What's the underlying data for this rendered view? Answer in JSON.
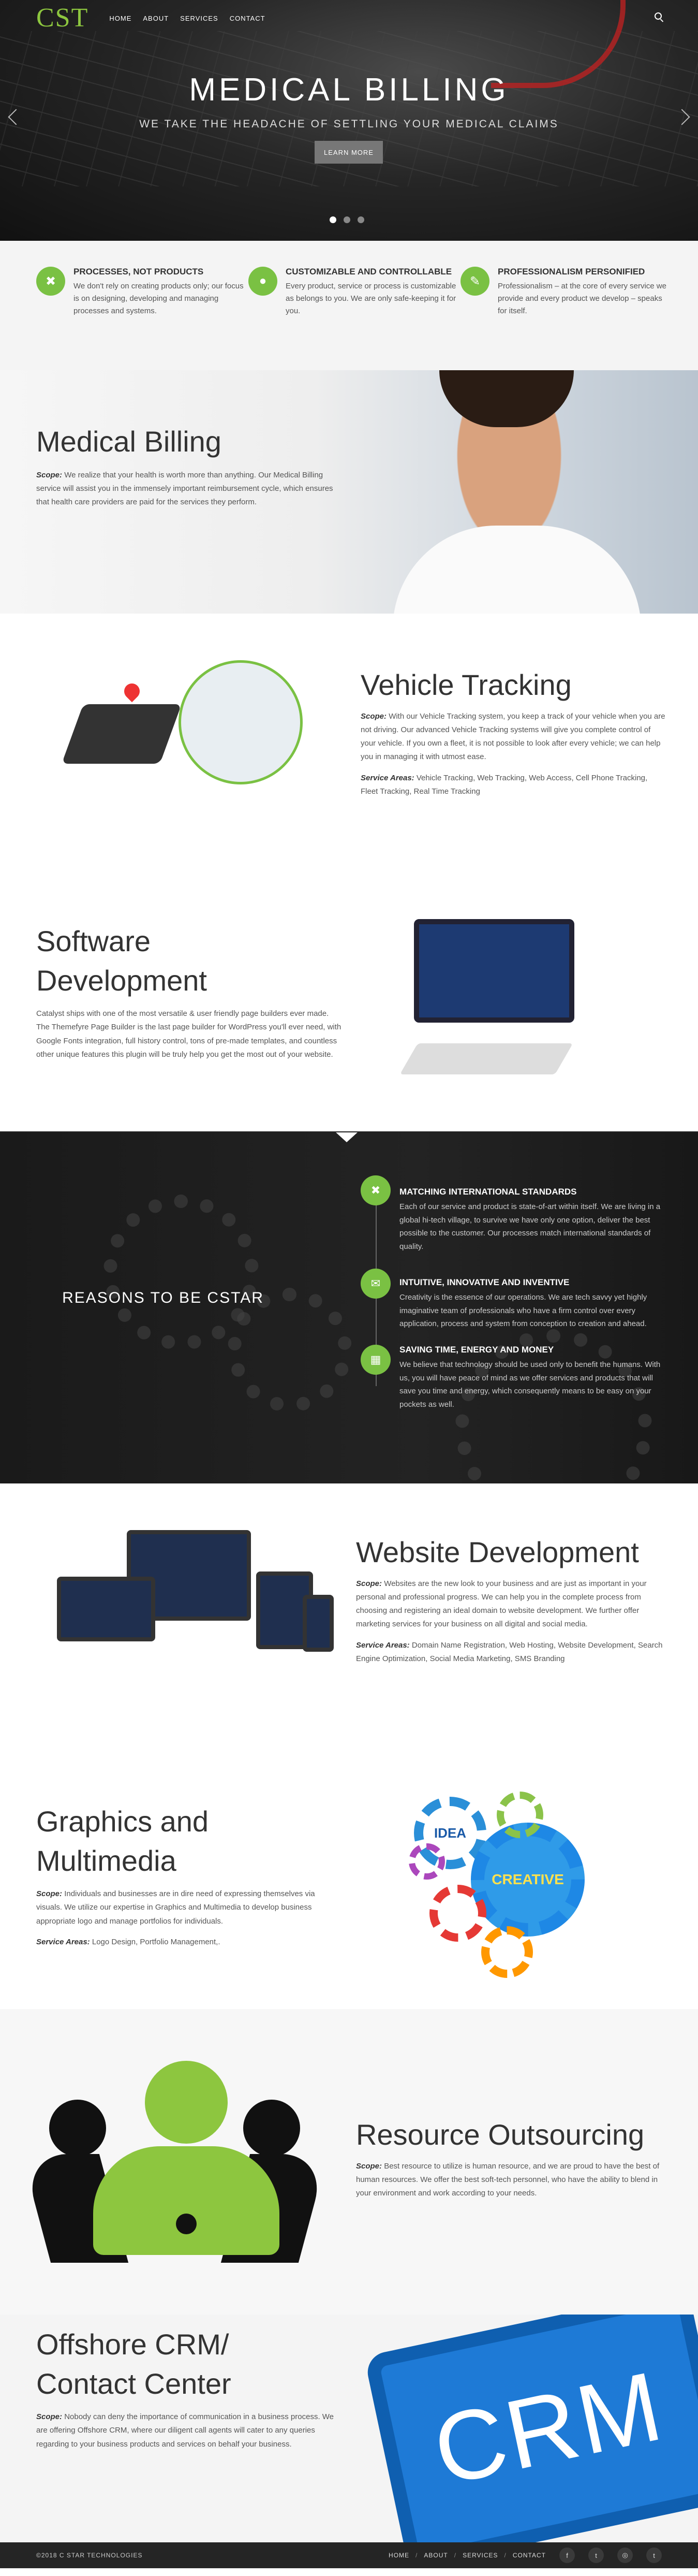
{
  "header": {
    "logo": "CST",
    "nav": [
      "HOME",
      "ABOUT",
      "SERVICES",
      "CONTACT"
    ]
  },
  "hero": {
    "title": "MEDICAL BILLING",
    "subtitle": "WE TAKE THE HEADACHE OF SETTLING YOUR MEDICAL CLAIMS",
    "button": "LEARN MORE",
    "slides": 3,
    "active_slide": 1
  },
  "features": [
    {
      "icon": "tools-icon",
      "glyph": "✖",
      "title": "PROCESSES, NOT PRODUCTS",
      "text": "We don't rely on creating products only; our focus is on designing, developing and managing processes and systems."
    },
    {
      "icon": "users-icon",
      "glyph": "●",
      "title": "CUSTOMIZABLE AND CONTROLLABLE",
      "text": "Every product, service or process is customizable as belongs to you. We are only safe-keeping it for you."
    },
    {
      "icon": "pencil-icon",
      "glyph": "✎",
      "title": "PROFESSIONALISM PERSONIFIED",
      "text": "Professionalism – at the core of every service we provide and every product we develop – speaks for itself."
    }
  ],
  "medical": {
    "title": "Medical Billing",
    "scope_label": "Scope:",
    "text": "We realize that your health is worth more than anything. Our Medical Billing service will assist you in the immensely important reimbursement cycle, which ensures that health care providers are paid for the services they perform."
  },
  "vehicle": {
    "title": "Vehicle Tracking",
    "scope_label": "Scope:",
    "text": "With our Vehicle Tracking system, you keep a track of your vehicle when you are not driving. Our advanced Vehicle Tracking systems will give you complete control of your vehicle. If you own a fleet, it is not possible to look after every vehicle; we can help you in managing it with utmost ease.",
    "areas_label": "Service Areas:",
    "areas": "Vehicle Tracking, Web Tracking, Web Access, Cell Phone Tracking, Fleet Tracking, Real Time Tracking"
  },
  "software": {
    "title_1": "Software",
    "title_2": "Development",
    "text": "Catalyst ships with one of the most versatile & user friendly page builders ever made. The Themefyre Page Builder is the last page builder for WordPress you'll ever need, with Google Fonts integration, full history control, tons of pre-made templates, and countless other unique features this plugin will be truly help you get the most out of your website."
  },
  "reasons": {
    "title": "REASONS TO BE CSTAR",
    "items": [
      {
        "icon": "tools-icon",
        "glyph": "✖",
        "title": "MATCHING INTERNATIONAL STANDARDS",
        "text": "Each of our service and product is state-of-art within itself. We are living in a global hi-tech village, to survive we have only one option, deliver the best possible to the customer. Our processes match international standards of quality."
      },
      {
        "icon": "chat-icon",
        "glyph": "✉",
        "title": "INTUITIVE, INNOVATIVE AND INVENTIVE",
        "text": "Creativity is the essence of our operations. We are tech savvy yet highly imaginative team of professionals who have a firm control over every application, process and system from conception to creation and ahead."
      },
      {
        "icon": "calendar-icon",
        "glyph": "▦",
        "title": "SAVING TIME, ENERGY AND MONEY",
        "text": "We believe that technology should be used only to benefit the humans. With us, you will have peace of mind as we offer services and products that will save you time and energy, which consequently means to be easy on your pockets as well."
      }
    ]
  },
  "website": {
    "title": "Website Development",
    "scope_label": "Scope:",
    "text": "Websites are the new look to your business and are just as important in your personal and professional progress. We can help you in the complete process from choosing and registering an ideal domain to website development. We further offer marketing services for your business on all digital and social media.",
    "areas_label": "Service Areas:",
    "areas": "Domain Name Registration, Web Hosting, Website Development, Search Engine Optimization, Social Media Marketing, SMS Branding"
  },
  "graphics": {
    "title_1": "Graphics and",
    "title_2": "Multimedia",
    "scope_label": "Scope:",
    "text": "Individuals and businesses are in dire need of expressing themselves via visuals. We utilize our expertise in Graphics and Multimedia to develop business appropriate logo and manage portfolios for individuals.",
    "areas_label": "Service Areas:",
    "areas": "Logo Design, Portfolio Management,.",
    "gear_idea": "IDEA",
    "gear_creative": "CREATIVE"
  },
  "resource": {
    "title": "Resource Outsourcing",
    "scope_label": "Scope:",
    "text": "Best resource to utilize is human resource, and we are proud to have the best of human resources. We offer the best soft-tech personnel, who have the ability to blend in your environment and work according to your needs."
  },
  "crm": {
    "title_1": "Offshore CRM/",
    "title_2": "Contact Center",
    "scope_label": "Scope:",
    "text": "Nobody can deny the importance of communication in a business process. We are offering Offshore CRM, where our diligent call agents will cater to any queries regarding to your business products and services on behalf your business.",
    "key_label": "CRM"
  },
  "footer": {
    "copyright": "©2018 C STAR TECHNOLOGIES",
    "nav": [
      "HOME",
      "ABOUT",
      "SERVICES",
      "CONTACT"
    ],
    "social": [
      {
        "icon": "facebook-icon",
        "glyph": "f"
      },
      {
        "icon": "twitter-icon",
        "glyph": "t"
      },
      {
        "icon": "instagram-icon",
        "glyph": "◎"
      },
      {
        "icon": "tumblr-icon",
        "glyph": "t"
      }
    ]
  },
  "colors": {
    "accent": "#7ac143",
    "dark": "#1f1f1f"
  }
}
